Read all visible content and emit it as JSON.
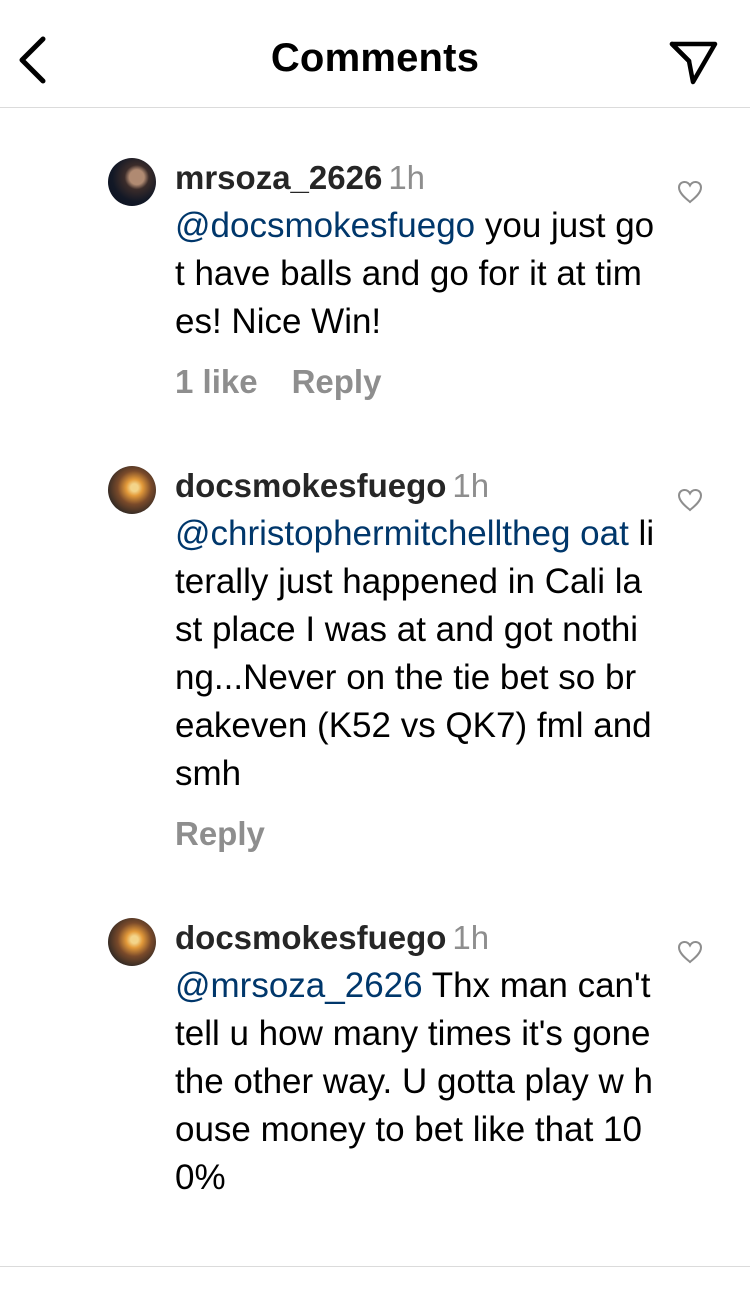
{
  "header": {
    "title": "Comments",
    "back_icon": "chevron-left-icon",
    "share_icon": "paper-plane-icon"
  },
  "colors": {
    "mention": "#00376b",
    "secondary_text": "#8e8e8e",
    "divider": "#dbdbdb"
  },
  "comments": [
    {
      "username": "mrsoza_2626",
      "time": "1h",
      "mention": "@docsmokesfuego",
      "text": " you just got have balls and go for it at times! Nice Win!",
      "likes": "1 like",
      "reply_label": "Reply"
    },
    {
      "username": "docsmokesfuego",
      "time": "1h",
      "mention": "@christophermitchelltheg oat",
      "text": " literally just happened in Cali last place I was at and got nothing...Never on the tie bet so breakeven (K52 vs QK7) fml and smh",
      "reply_label": "Reply"
    },
    {
      "username": "docsmokesfuego",
      "time": "1h",
      "mention": "@mrsoza_2626",
      "text": " Thx man can't tell u how many times it's gone the other way. U gotta play w house money to bet like that 100%"
    }
  ]
}
